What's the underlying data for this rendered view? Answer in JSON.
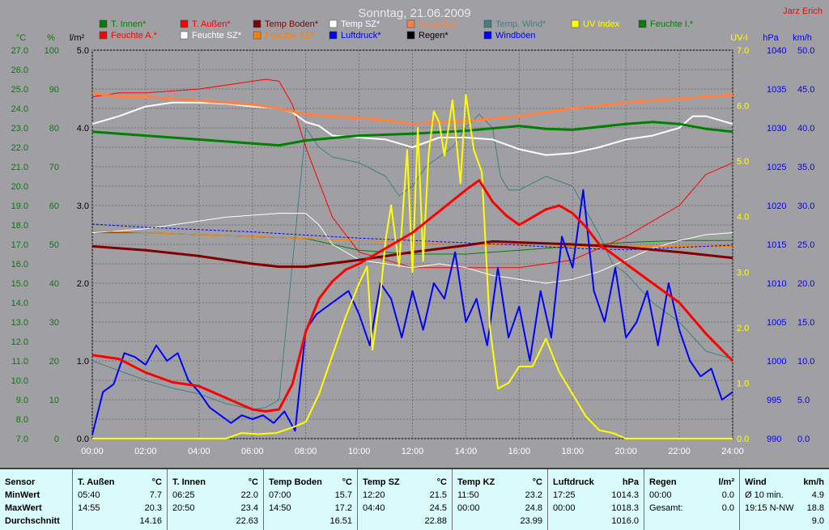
{
  "chart_data": {
    "type": "line",
    "title": "Sonntag, 21.06.2009",
    "author": "Jarz Erich",
    "x_ticks": [
      "00:00",
      "02:00",
      "04:00",
      "06:00",
      "08:00",
      "10:00",
      "12:00",
      "14:00",
      "16:00",
      "18:00",
      "20:00",
      "22:00",
      "24:00"
    ],
    "axes": {
      "temp": {
        "unit": "°C",
        "ticks": [
          "27.0",
          "26.0",
          "25.0",
          "24.0",
          "23.0",
          "22.0",
          "21.0",
          "20.0",
          "19.0",
          "18.0",
          "17.0",
          "16.0",
          "15.0",
          "14.0",
          "13.0",
          "12.0",
          "11.0",
          "10.0",
          "9.0",
          "8.0",
          "7.0"
        ],
        "range": [
          7,
          27
        ]
      },
      "humidity": {
        "unit": "%",
        "ticks": [
          "100",
          "90",
          "80",
          "70",
          "60",
          "50",
          "40",
          "30",
          "20",
          "10",
          "0"
        ],
        "range": [
          0,
          100
        ]
      },
      "rain": {
        "unit": "l/m²",
        "ticks": [
          "5.0",
          "4.0",
          "3.0",
          "2.0",
          "1.0",
          "0.0"
        ],
        "range": [
          0,
          5
        ]
      },
      "uv": {
        "unit": "UV-I",
        "ticks": [
          "7.0",
          "6.0",
          "5.0",
          "4.0",
          "3.0",
          "2.0",
          "1.0",
          "0.0"
        ],
        "range": [
          0,
          7
        ]
      },
      "pressure": {
        "unit": "hPa",
        "ticks": [
          "1040",
          "1035",
          "1030",
          "1025",
          "1020",
          "1015",
          "1010",
          "1005",
          "1000",
          "995",
          "990"
        ],
        "range": [
          990,
          1040
        ]
      },
      "wind": {
        "unit": "km/h",
        "ticks": [
          "50.0",
          "45.0",
          "40.0",
          "35.0",
          "30.0",
          "25.0",
          "20.0",
          "15.0",
          "10.0",
          "5.0",
          "0.0"
        ],
        "range": [
          0,
          50
        ]
      }
    },
    "legend": [
      {
        "label": "T. Innen*",
        "color": "#008000"
      },
      {
        "label": "T. Außen*",
        "color": "#ff0000"
      },
      {
        "label": "Temp Boden*",
        "color": "#800000"
      },
      {
        "label": "Temp SZ*",
        "color": "#ffffff"
      },
      {
        "label": "Temp KZ*",
        "color": "#ff8040"
      },
      {
        "label": "Temp. Wind*",
        "color": "#408080"
      },
      {
        "label": "UV Index",
        "color": "#ffff00"
      },
      {
        "label": "Feuchte I.*",
        "color": "#008000"
      },
      {
        "label": "Feuchte A.*",
        "color": "#ff0000"
      },
      {
        "label": "Feuchte SZ*",
        "color": "#ffffff"
      },
      {
        "label": "Feuchte KZ*",
        "color": "#ff8000"
      },
      {
        "label": "Luftdruck*",
        "color": "#0000ff"
      },
      {
        "label": "Regen*",
        "color": "#000000"
      },
      {
        "label": "Windböen",
        "color": "#0000ff"
      }
    ],
    "series": [
      {
        "name": "T. Innen*",
        "axis": "temp",
        "color": "#008000",
        "width": 3,
        "x": [
          0,
          2,
          4,
          6,
          7,
          8,
          10,
          12,
          14,
          16,
          17,
          18,
          19,
          20,
          21,
          22,
          23,
          24
        ],
        "y": [
          22.8,
          22.6,
          22.4,
          22.2,
          22.1,
          22.35,
          22.6,
          22.7,
          22.85,
          23.1,
          22.95,
          22.9,
          23.05,
          23.2,
          23.3,
          23.2,
          22.95,
          22.8
        ]
      },
      {
        "name": "T. Außen*",
        "axis": "temp",
        "color": "#ff0000",
        "width": 3,
        "x": [
          0,
          1,
          2,
          3,
          4,
          5,
          6,
          6.5,
          7,
          7.5,
          8,
          8.5,
          9,
          9.5,
          10,
          11,
          12,
          13,
          14,
          14.5,
          15,
          15.5,
          16,
          16.5,
          17,
          17.5,
          18,
          18.5,
          19,
          19.5,
          20,
          21,
          22,
          23,
          24
        ],
        "y": [
          11.3,
          11.1,
          10.4,
          9.9,
          9.7,
          9.1,
          8.5,
          8.4,
          8.5,
          9.8,
          12.5,
          14.2,
          15.1,
          15.7,
          16.0,
          16.8,
          17.6,
          18.7,
          19.8,
          20.3,
          19.2,
          18.5,
          18.0,
          18.4,
          18.8,
          19.0,
          18.6,
          17.9,
          17.0,
          16.5,
          16.0,
          15.0,
          14.0,
          12.4,
          11.0
        ]
      },
      {
        "name": "Temp Boden*",
        "axis": "temp",
        "color": "#800000",
        "width": 3,
        "x": [
          0,
          2,
          4,
          6,
          7,
          8,
          10,
          12,
          14,
          15,
          16,
          18,
          20,
          22,
          24
        ],
        "y": [
          16.9,
          16.7,
          16.4,
          16.0,
          15.85,
          15.85,
          16.2,
          16.6,
          16.95,
          17.15,
          17.1,
          17.0,
          16.85,
          16.6,
          16.3
        ]
      },
      {
        "name": "Temp SZ*",
        "axis": "temp",
        "color": "#ffffff",
        "width": 2,
        "x": [
          0,
          1,
          2,
          3,
          4,
          5,
          6,
          7,
          7.5,
          8,
          8.5,
          9,
          10,
          11,
          12,
          13,
          14,
          15,
          16,
          17,
          18,
          19,
          20,
          21,
          22,
          22.5,
          23,
          24
        ],
        "y": [
          23.2,
          23.6,
          24.1,
          24.3,
          24.3,
          24.25,
          24.1,
          24.0,
          23.8,
          23.3,
          23.1,
          22.6,
          22.5,
          22.4,
          22.0,
          22.5,
          22.5,
          22.4,
          21.9,
          21.6,
          21.7,
          22.0,
          22.4,
          22.6,
          23.0,
          23.6,
          23.6,
          23.2
        ]
      },
      {
        "name": "Temp KZ*",
        "axis": "temp",
        "color": "#ff8040",
        "width": 3,
        "x": [
          0,
          1,
          2,
          3,
          4,
          5,
          6,
          7,
          8,
          9,
          10,
          11,
          12,
          13,
          14,
          16,
          18,
          20,
          22,
          24
        ],
        "y": [
          24.8,
          24.6,
          24.6,
          24.5,
          24.4,
          24.3,
          24.2,
          24.0,
          23.7,
          23.6,
          23.5,
          23.4,
          23.2,
          23.3,
          23.35,
          23.6,
          24.0,
          24.3,
          24.5,
          24.7
        ]
      },
      {
        "name": "Temp. Wind*",
        "axis": "temp",
        "color": "#408080",
        "width": 1,
        "x": [
          0,
          1,
          2,
          3,
          4,
          5,
          6,
          6.5,
          7,
          7.5,
          8,
          8.5,
          9,
          10,
          11,
          11.5,
          12,
          12.5,
          13,
          13.5,
          14,
          14.5,
          15,
          15.3,
          15.6,
          16,
          17,
          18,
          19,
          19.5,
          20,
          21,
          22,
          23,
          24
        ],
        "y": [
          11.0,
          10.5,
          10.0,
          9.6,
          9.3,
          8.8,
          8.5,
          8.6,
          9.0,
          16.0,
          23.0,
          22.0,
          21.5,
          21.2,
          20.5,
          19.5,
          20.0,
          21.0,
          21.5,
          22.0,
          23.0,
          23.7,
          23.0,
          20.5,
          19.8,
          19.8,
          20.5,
          20.0,
          17.5,
          16.0,
          15.5,
          14.0,
          13.0,
          11.5,
          11.1
        ]
      },
      {
        "name": "Feuchte I.*",
        "axis": "humidity",
        "color": "#008000",
        "width": 1,
        "x": [
          0,
          2,
          4,
          6,
          8,
          10,
          12,
          14,
          16,
          18,
          20,
          22,
          24
        ],
        "y": [
          53,
          53,
          52.5,
          52,
          51.5,
          48.5,
          47.5,
          47.5,
          48.5,
          49.5,
          50.5,
          51,
          51
        ]
      },
      {
        "name": "Feuchte A.*",
        "axis": "humidity",
        "color": "#ff0000",
        "width": 1,
        "x": [
          0,
          1,
          2,
          3,
          4,
          5,
          6,
          6.5,
          7,
          7.5,
          8,
          8.5,
          9,
          10,
          11,
          12,
          13,
          14,
          15,
          16,
          17,
          18,
          19,
          20,
          21,
          22,
          23,
          24
        ],
        "y": [
          88,
          89,
          89,
          89.5,
          90,
          91,
          92,
          92.5,
          92,
          86,
          75,
          66,
          57,
          48,
          46,
          44,
          44,
          44,
          44,
          44,
          45,
          46,
          49,
          52,
          56,
          60,
          68,
          71
        ]
      },
      {
        "name": "Feuchte SZ*",
        "axis": "humidity",
        "color": "#ffffff",
        "width": 1,
        "x": [
          0,
          1,
          2,
          3,
          4,
          5,
          6,
          7,
          8,
          8.5,
          9,
          10,
          11,
          12,
          13,
          14,
          15,
          16,
          17,
          18,
          19,
          20,
          21,
          22,
          23,
          24
        ],
        "y": [
          53,
          53.5,
          54,
          55,
          56,
          57,
          57.5,
          58,
          58,
          55,
          50,
          46,
          45,
          44,
          45,
          44,
          42,
          41,
          40,
          41,
          43,
          46,
          49,
          51,
          52.5,
          53
        ]
      },
      {
        "name": "Feuchte KZ*",
        "axis": "humidity",
        "color": "#ff8000",
        "width": 1,
        "x": [
          0,
          2,
          4,
          6,
          8,
          10,
          12,
          14,
          16,
          18,
          20,
          22,
          24
        ],
        "y": [
          53.5,
          53,
          52.5,
          52,
          51.5,
          51,
          50.5,
          50,
          49.8,
          49.5,
          49.5,
          49.5,
          49.5
        ]
      },
      {
        "name": "Luftdruck*",
        "axis": "pressure",
        "color": "#0000ff",
        "width": 1,
        "dash": "3,2",
        "x": [
          0,
          2,
          4,
          6,
          8,
          10,
          12,
          14,
          16,
          18,
          20,
          22,
          24
        ],
        "y": [
          1017.6,
          1017.2,
          1016.9,
          1016.6,
          1016.2,
          1015.8,
          1015.5,
          1015.2,
          1014.9,
          1014.5,
          1014.3,
          1014.6,
          1014.9
        ]
      },
      {
        "name": "UV Index",
        "axis": "uv",
        "color": "#ffff00",
        "width": 2,
        "x": [
          0,
          5,
          5.6,
          6.2,
          6.9,
          7.5,
          8,
          8.5,
          9,
          9.5,
          10,
          10.3,
          10.5,
          10.8,
          11.0,
          11.2,
          11.5,
          11.8,
          12.0,
          12.2,
          12.4,
          12.6,
          12.8,
          13.0,
          13.2,
          13.5,
          13.8,
          14.0,
          14.3,
          14.6,
          14.9,
          15.2,
          15.6,
          16.0,
          16.5,
          17.0,
          17.5,
          18.0,
          18.5,
          19.0,
          19.5,
          20.0,
          24.0
        ],
        "y": [
          0,
          0,
          0.1,
          0.08,
          0.1,
          0.2,
          0.3,
          0.8,
          1.5,
          2.2,
          2.8,
          3.1,
          1.6,
          2.6,
          3.6,
          4.2,
          3.1,
          5.2,
          3.0,
          5.6,
          3.2,
          5.1,
          5.9,
          5.7,
          5.1,
          6.1,
          4.6,
          6.2,
          5.2,
          4.8,
          2.0,
          0.9,
          1.0,
          1.3,
          1.3,
          1.8,
          1.2,
          0.8,
          0.4,
          0.15,
          0.1,
          0,
          0
        ]
      },
      {
        "name": "Windböen",
        "axis": "wind",
        "color": "#0000ff",
        "width": 2,
        "x": [
          0,
          0.4,
          0.8,
          1.2,
          1.6,
          2.0,
          2.4,
          2.8,
          3.2,
          3.6,
          4.0,
          4.4,
          4.8,
          5.2,
          5.6,
          6.0,
          6.4,
          6.8,
          7.2,
          7.6,
          8.0,
          8.4,
          8.8,
          9.2,
          9.6,
          10.0,
          10.4,
          10.8,
          11.2,
          11.6,
          12.0,
          12.4,
          12.8,
          13.2,
          13.6,
          14.0,
          14.4,
          14.8,
          15.2,
          15.6,
          16.0,
          16.4,
          16.8,
          17.2,
          17.6,
          18.0,
          18.4,
          18.8,
          19.2,
          19.6,
          20.0,
          20.4,
          20.8,
          21.2,
          21.6,
          22.0,
          22.4,
          22.8,
          23.2,
          23.6,
          24.0
        ],
        "y": [
          0.5,
          6,
          7,
          11,
          10.5,
          9.5,
          12,
          10,
          11,
          7.5,
          6,
          4,
          3,
          2,
          3,
          2.5,
          3,
          2,
          3.5,
          1,
          14,
          16,
          17,
          18,
          19,
          16,
          12,
          20,
          18,
          13,
          19,
          14,
          20,
          18,
          24,
          15,
          18,
          12,
          22,
          13,
          17,
          10,
          19,
          13,
          26,
          22,
          32,
          19,
          15,
          22,
          13,
          15,
          19,
          12,
          20,
          14,
          10,
          8,
          9,
          5,
          6
        ]
      }
    ],
    "stats": {
      "columns": [
        {
          "header": "Sensor",
          "unit": "",
          "rows": [
            [
              "MinWert",
              ""
            ],
            [
              "MaxWert",
              ""
            ],
            [
              "Durchschnitt",
              ""
            ]
          ]
        },
        {
          "header": "T. Außen",
          "unit": "°C",
          "rows": [
            [
              "05:40",
              "7.7"
            ],
            [
              "14:55",
              "20.3"
            ],
            [
              "",
              "14.16"
            ]
          ]
        },
        {
          "header": "T. Innen",
          "unit": "°C",
          "rows": [
            [
              "06:25",
              "22.0"
            ],
            [
              "20:50",
              "23.4"
            ],
            [
              "",
              "22.63"
            ]
          ]
        },
        {
          "header": "Temp Boden",
          "unit": "°C",
          "rows": [
            [
              "07:00",
              "15.7"
            ],
            [
              "14:50",
              "17.2"
            ],
            [
              "",
              "16.51"
            ]
          ]
        },
        {
          "header": "Temp SZ",
          "unit": "°C",
          "rows": [
            [
              "12:20",
              "21.5"
            ],
            [
              "04:40",
              "24.5"
            ],
            [
              "",
              "22.88"
            ]
          ]
        },
        {
          "header": "Temp KZ",
          "unit": "°C",
          "rows": [
            [
              "11:50",
              "23.2"
            ],
            [
              "00:00",
              "24.8"
            ],
            [
              "",
              "23.99"
            ]
          ]
        },
        {
          "header": "Luftdruck",
          "unit": "hPa",
          "rows": [
            [
              "17:25",
              "1014.3"
            ],
            [
              "00:00",
              "1018.3"
            ],
            [
              "",
              "1016.0"
            ]
          ]
        },
        {
          "header": "Regen",
          "unit": "l/m²",
          "rows": [
            [
              "00:00",
              "0.0"
            ],
            [
              "Gesamt:",
              "0.0"
            ],
            [
              "",
              ""
            ]
          ]
        },
        {
          "header": "Wind",
          "unit": "km/h",
          "rows": [
            [
              "Ø 10 min.",
              "4.9"
            ],
            [
              "19:15   N-NW",
              "18.8"
            ],
            [
              "",
              "9.0"
            ]
          ]
        }
      ]
    }
  }
}
